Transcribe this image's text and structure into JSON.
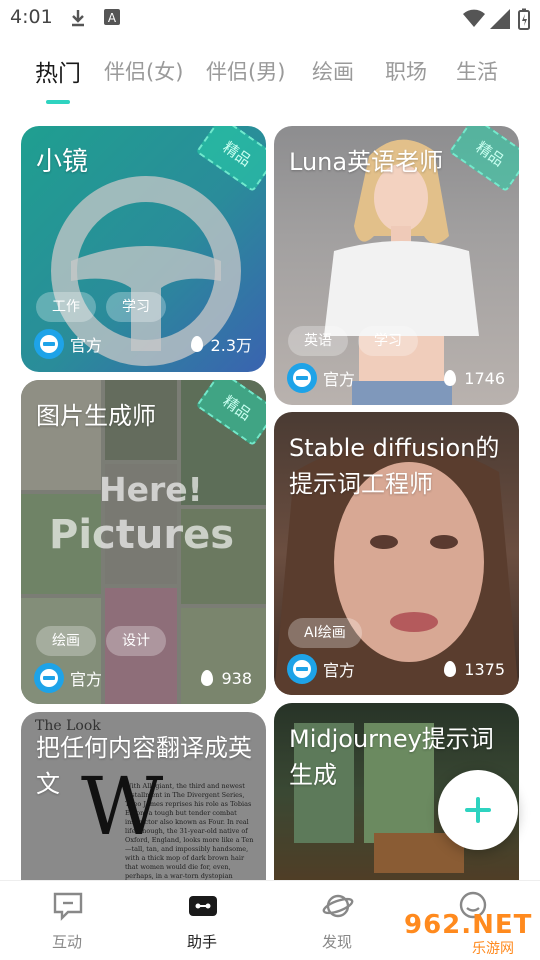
{
  "status": {
    "time": "4:01"
  },
  "tabs": [
    {
      "label": "热门"
    },
    {
      "label": "伴侣(女)"
    },
    {
      "label": "伴侣(男)"
    },
    {
      "label": "绘画"
    },
    {
      "label": "职场"
    },
    {
      "label": "生活"
    }
  ],
  "cards": [
    {
      "title": "小镜",
      "tags": [
        "工作",
        "学习"
      ],
      "owner": "官方",
      "heat": "2.3万",
      "badge": "精品"
    },
    {
      "title": "Luna英语老师",
      "tags": [
        "英语",
        "学习"
      ],
      "owner": "官方",
      "heat": "1746",
      "badge": "精品"
    },
    {
      "title": "图片生成师",
      "tags": [
        "绘画",
        "设计"
      ],
      "owner": "官方",
      "heat": "938",
      "badge": "精品",
      "art_text": [
        "Here!",
        "Pictures"
      ]
    },
    {
      "title": "Stable diffusion的提示词工程师",
      "tags": [
        "AI绘画"
      ],
      "owner": "官方",
      "heat": "1375"
    },
    {
      "title": "把任何内容翻译成英文",
      "art_text": [
        "The Look",
        "With Allegiant, the third and newest installment in The Divergent Series, Theo James reprises his role as Tobias Eaton, a tough but tender combat instructor also known as Four. In real life, though, the 31-year-old native of Oxford, England, looks more like a Ten—tall, tan, and impossibly handsome, with a thick mop of dark brown hair that women would die for, even, perhaps, in a war-torn dystopian world. Today, despite a dreary London downpour, James is dressed to kill in brown, in one immaculate checked shirt to a distressed-leather jacket and lace-up boots. But he's quick to point out he wasn't always so style-"
      ]
    },
    {
      "title": "Midjourney提示词生成"
    }
  ],
  "nav": [
    {
      "label": "互动"
    },
    {
      "label": "助手"
    },
    {
      "label": "发现"
    }
  ],
  "watermark": {
    "main": "962.NET",
    "sub": "乐游网"
  },
  "colors": {
    "accent": "#2ed3c0",
    "owner_logo": "#1ea3e8"
  }
}
